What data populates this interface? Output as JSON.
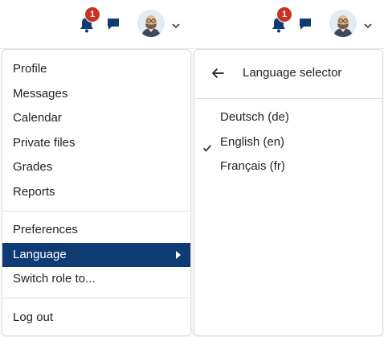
{
  "navbar": {
    "notification_count": "1"
  },
  "user_menu": {
    "items": [
      {
        "label": "Profile"
      },
      {
        "label": "Messages"
      },
      {
        "label": "Calendar"
      },
      {
        "label": "Private files"
      },
      {
        "label": "Grades"
      },
      {
        "label": "Reports"
      }
    ],
    "items2": [
      {
        "label": "Preferences"
      },
      {
        "label": "Language"
      },
      {
        "label": "Switch role to..."
      }
    ],
    "logout_label": "Log out"
  },
  "language_selector": {
    "title": "Language selector",
    "languages": [
      {
        "label": "Deutsch (de)",
        "selected": false
      },
      {
        "label": "English (en)",
        "selected": true
      },
      {
        "label": "Français (fr)",
        "selected": false
      }
    ]
  },
  "colors": {
    "accent": "#0f3b74",
    "badge": "#ca3120"
  }
}
